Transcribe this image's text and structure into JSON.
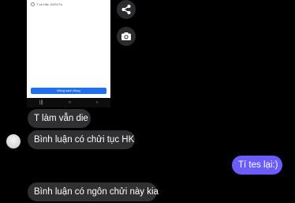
{
  "screenshot": {
    "list_row_text": "T và Hắc 100% Fe",
    "button_label": "Đăng sách đồng",
    "nav": {
      "recents": "|||",
      "home": "○",
      "back": "‹"
    }
  },
  "actions": {
    "share_icon": "share-icon",
    "camera_icon": "camera-icon"
  },
  "messages": [
    {
      "sender": "other",
      "text": "T làm vẫn die"
    },
    {
      "sender": "other",
      "text": "Bình luận có chửi tục HK"
    },
    {
      "sender": "me",
      "text": "Tí tes lại:)"
    },
    {
      "sender": "other",
      "text": "Bình luận có ngôn chửi này kia"
    }
  ],
  "colors": {
    "background": "#000000",
    "incoming_bubble": "#303033",
    "outgoing_bubble": "#6a5cff",
    "accent_button": "#1e6ff2"
  }
}
